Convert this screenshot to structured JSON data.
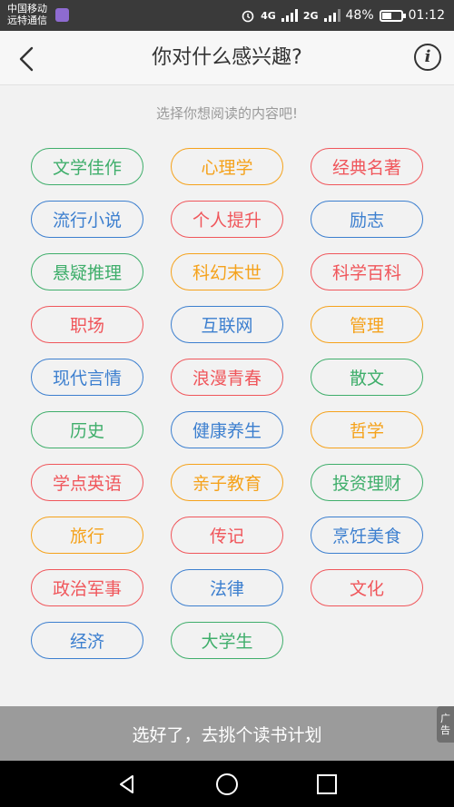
{
  "status_bar": {
    "carrier_line1": "中国移动",
    "carrier_line2": "远特通信",
    "network1": "4G",
    "network2": "2G",
    "battery": "48%",
    "battery_level": 0.48,
    "time": "01:12"
  },
  "header": {
    "title": "你对什么感兴趣?",
    "back_icon": "chevron-left-icon",
    "info_icon": "info-icon",
    "info_glyph": "i"
  },
  "subtitle": "选择你想阅读的内容吧!",
  "colors": {
    "green": "#3fae6b",
    "orange": "#f5a21b",
    "red": "#f0565b",
    "blue": "#3c7fcf"
  },
  "tags": [
    {
      "label": "文学佳作",
      "color": "#3fae6b"
    },
    {
      "label": "心理学",
      "color": "#f5a21b"
    },
    {
      "label": "经典名著",
      "color": "#f0565b"
    },
    {
      "label": "流行小说",
      "color": "#3c7fcf"
    },
    {
      "label": "个人提升",
      "color": "#f0565b"
    },
    {
      "label": "励志",
      "color": "#3c7fcf"
    },
    {
      "label": "悬疑推理",
      "color": "#3fae6b"
    },
    {
      "label": "科幻末世",
      "color": "#f5a21b"
    },
    {
      "label": "科学百科",
      "color": "#f0565b"
    },
    {
      "label": "职场",
      "color": "#f0565b"
    },
    {
      "label": "互联网",
      "color": "#3c7fcf"
    },
    {
      "label": "管理",
      "color": "#f5a21b"
    },
    {
      "label": "现代言情",
      "color": "#3c7fcf"
    },
    {
      "label": "浪漫青春",
      "color": "#f0565b"
    },
    {
      "label": "散文",
      "color": "#3fae6b"
    },
    {
      "label": "历史",
      "color": "#3fae6b"
    },
    {
      "label": "健康养生",
      "color": "#3c7fcf"
    },
    {
      "label": "哲学",
      "color": "#f5a21b"
    },
    {
      "label": "学点英语",
      "color": "#f0565b"
    },
    {
      "label": "亲子教育",
      "color": "#f5a21b"
    },
    {
      "label": "投资理财",
      "color": "#3fae6b"
    },
    {
      "label": "旅行",
      "color": "#f5a21b"
    },
    {
      "label": "传记",
      "color": "#f0565b"
    },
    {
      "label": "烹饪美食",
      "color": "#3c7fcf"
    },
    {
      "label": "政治军事",
      "color": "#f0565b"
    },
    {
      "label": "法律",
      "color": "#3c7fcf"
    },
    {
      "label": "文化",
      "color": "#f0565b"
    },
    {
      "label": "经济",
      "color": "#3c7fcf"
    },
    {
      "label": "大学生",
      "color": "#3fae6b"
    }
  ],
  "confirm_button": "选好了，去挑个读书计划",
  "ad_tab": {
    "line1": "广",
    "line2": "告"
  },
  "nav_bar": {
    "back_icon": "triangle-back-icon",
    "home_icon": "circle-home-icon",
    "recents_icon": "square-recents-icon"
  }
}
